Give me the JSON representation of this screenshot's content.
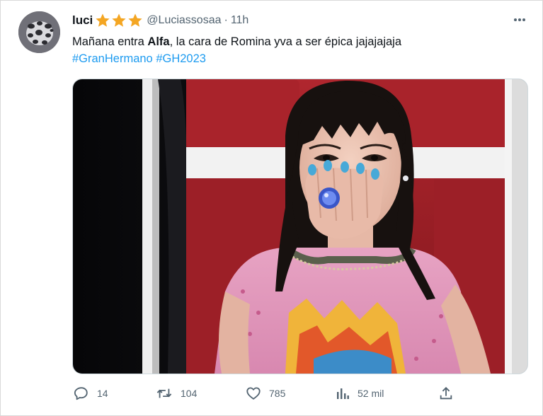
{
  "tweet": {
    "author": {
      "name": "luci",
      "handle": "@Luciassosaa",
      "badge_icon": "star-icon",
      "badge_color": "#f4a623"
    },
    "separator": "·",
    "time": "11h",
    "text_before": "Mañana entra ",
    "text_bold": "Alfa",
    "text_after": ", la cara de Romina yva a ser épica jajajajaja",
    "hashtags": [
      "#GranHermano",
      "#GH2023"
    ],
    "link_color": "#1d9bf0"
  },
  "actions": {
    "replies": "14",
    "retweets": "104",
    "likes": "785",
    "views": "52 mil"
  }
}
